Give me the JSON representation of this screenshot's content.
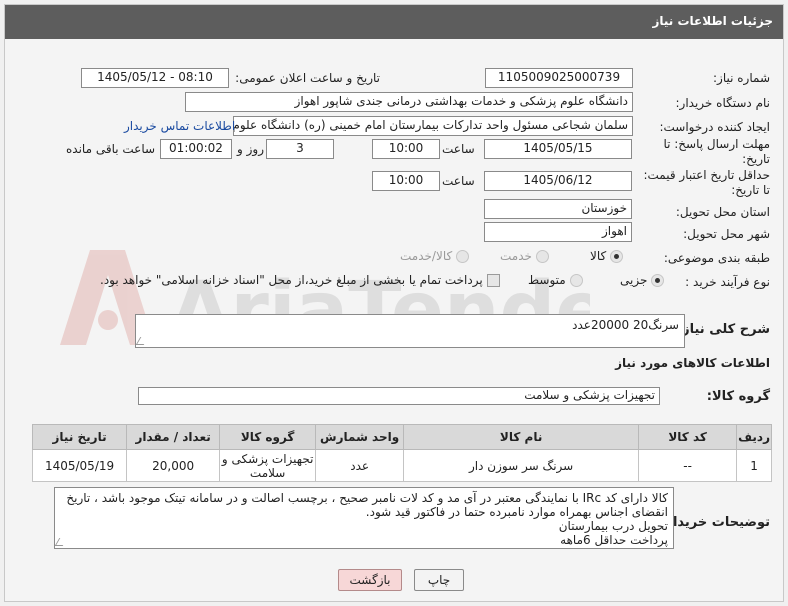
{
  "header": {
    "title": "جزئیات اطلاعات نیاز"
  },
  "form": {
    "need_number_label": "شماره نیاز:",
    "need_number": "1105009025000739",
    "announce_label": "تاریخ و ساعت اعلان عمومی:",
    "announce_value": "1405/05/12 - 08:10",
    "buyer_org_label": "نام دستگاه خریدار:",
    "buyer_org": "دانشگاه علوم پزشکی و خدمات بهداشتی درمانی جندی شاپور اهواز",
    "requester_label": "ایجاد کننده درخواست:",
    "requester": "سلمان شجاعی مسئول واحد تدارکات بیمارستان امام خمینی (ره) دانشگاه علوم",
    "contact_link": "اطلاعات تماس خریدار",
    "deadline_label_1": "مهلت ارسال پاسخ: تا",
    "deadline_label_2": "تاریخ:",
    "deadline_date": "1405/05/15",
    "time_label": "ساعت",
    "deadline_time": "10:00",
    "days_value": "3",
    "days_label": "روز و",
    "remaining_time": "01:00:02",
    "remaining_label": "ساعت باقی مانده",
    "validity_label_1": "حداقل تاریخ اعتبار قیمت:",
    "validity_label_2": "تا تاریخ:",
    "validity_date": "1405/06/12",
    "validity_time": "10:00",
    "province_label": "استان محل تحویل:",
    "province": "خوزستان",
    "city_label": "شهر محل تحویل:",
    "city": "اهواز",
    "category_label": "طبقه بندی موضوعی:",
    "category_options": [
      "کالا",
      "خدمت",
      "کالا/خدمت"
    ],
    "process_label": "نوع فرآیند خرید :",
    "process_options": [
      "جزیی",
      "متوسط"
    ],
    "payment_note": "پرداخت تمام یا بخشی از مبلغ خرید،از محل \"اسناد خزانه اسلامی\" خواهد بود."
  },
  "description": {
    "label": "شرح کلی نیاز:",
    "value": "سرنگ20      20000عدد"
  },
  "goods": {
    "section_title": "اطلاعات کالاهای مورد نیاز",
    "group_label": "گروه کالا:",
    "group_value": "تجهیزات پزشکی و سلامت"
  },
  "table": {
    "headers": [
      "ردیف",
      "کد کالا",
      "نام کالا",
      "واحد شمارش",
      "گروه کالا",
      "تعداد / مقدار",
      "تاریخ نیاز"
    ],
    "rows": [
      [
        "1",
        "--",
        "سرنگ سر سوزن دار",
        "عدد",
        "تجهیزات پزشکی و سلامت",
        "20,000",
        "1405/05/19"
      ]
    ]
  },
  "buyer_notes": {
    "label": "توضیحات خریدار:",
    "lines": [
      "کالا دارای کد IRc با نمایندگی معتبر در آی مد و کد لات نامبر صحیح ، برچسب اصالت و در سامانه تیتک موجود باشد ، تاریخ",
      "انقضای اجناس بهمراه موارد نامبرده حتما در فاکتور قید شود.",
      "تحویل درب بیمارستان",
      "پرداخت حداقل 6ماهه"
    ]
  },
  "buttons": {
    "print": "چاپ",
    "back": "بازگشت"
  },
  "watermark": {
    "text": "AriaTender.net"
  }
}
